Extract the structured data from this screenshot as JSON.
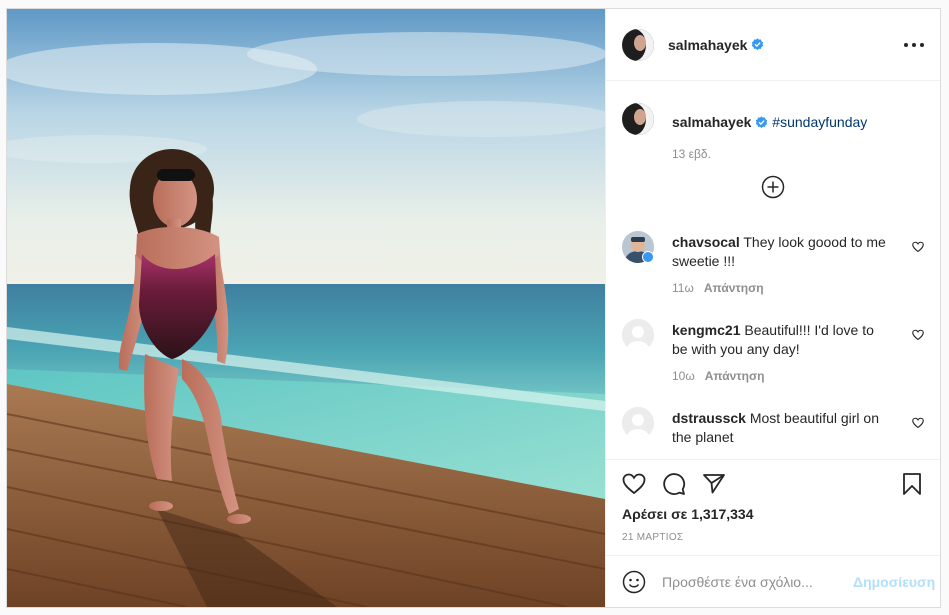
{
  "post": {
    "username": "salmahayek",
    "verified": true,
    "menu_icon": "more-horizontal-icon"
  },
  "caption": {
    "username": "salmahayek",
    "text": "#sundayfunday",
    "time": "13 εβδ."
  },
  "load_more_icon": "plus-circle-icon",
  "comments": [
    {
      "username": "chavsocal",
      "text": "They look goood to me sweetie !!!",
      "time": "11ω",
      "reply": "Απάντηση"
    },
    {
      "username": "kengmc21",
      "text": "Beautiful!!! I'd love to be with you any day!",
      "time": "10ω",
      "reply": "Απάντηση"
    },
    {
      "username": "dstraussck",
      "text": "Most beautiful girl on the planet"
    }
  ],
  "actions": {
    "likes_label": "Αρέσει σε 1,317,334",
    "date": "21 ΜΑΡΤΙΟΣ"
  },
  "add_comment": {
    "placeholder": "Προσθέστε ένα σχόλιο...",
    "post_label": "Δημοσίευση"
  },
  "colors": {
    "link": "#00376b",
    "verified_badge": "#3897f0",
    "post_button_disabled": "#b2dffc"
  }
}
